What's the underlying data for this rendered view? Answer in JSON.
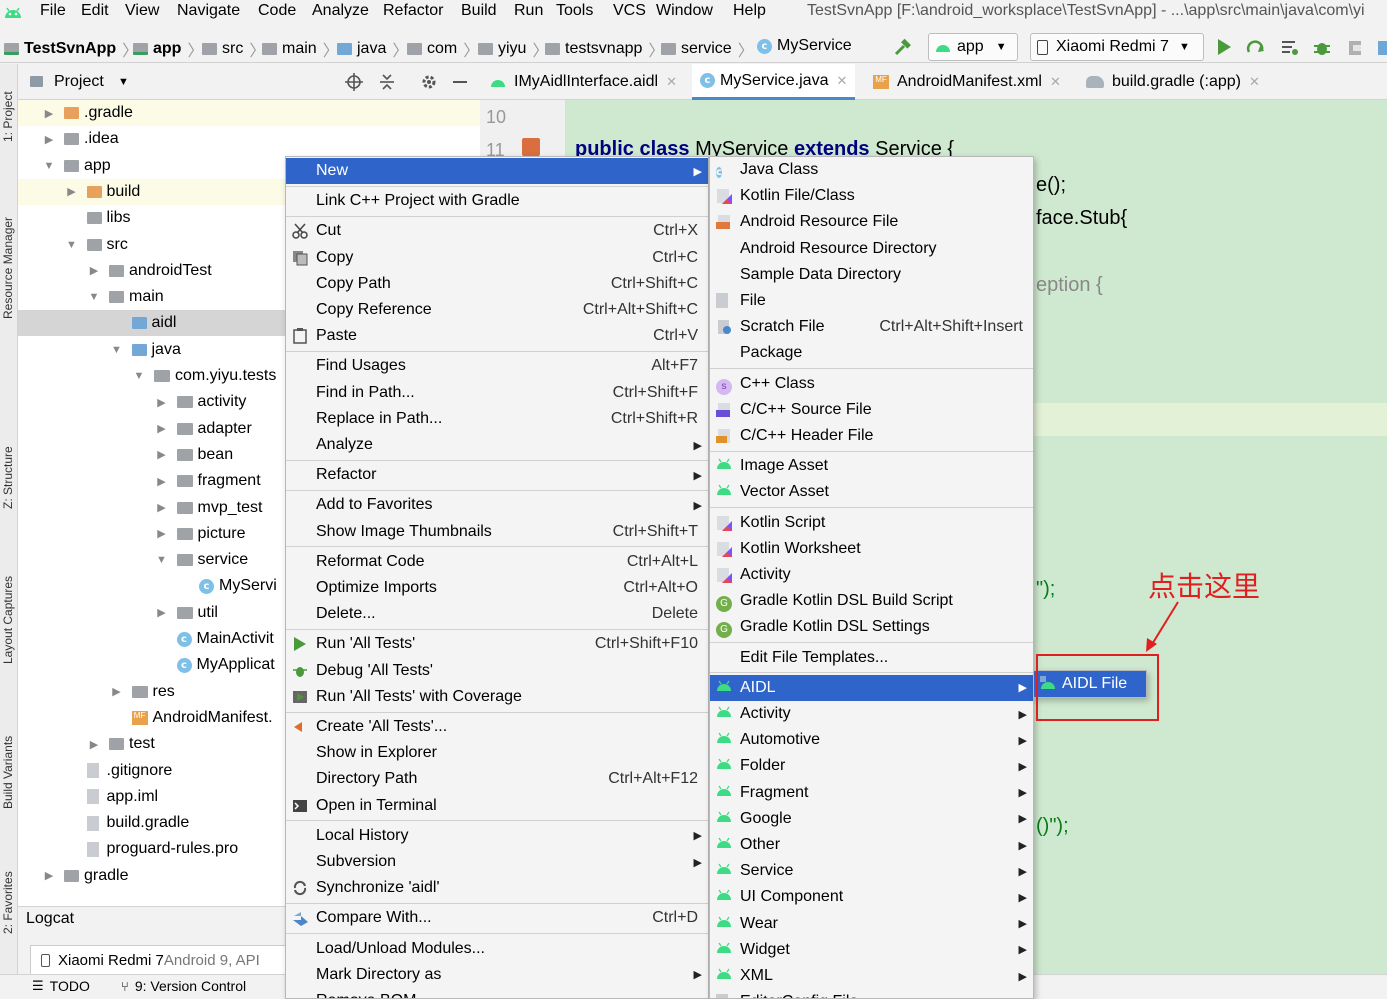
{
  "menubar": {
    "items": [
      "File",
      "Edit",
      "View",
      "Navigate",
      "Code",
      "Analyze",
      "Refactor",
      "Build",
      "Run",
      "Tools",
      "VCS",
      "Window",
      "Help"
    ],
    "title": "TestSvnApp [F:\\android_worksplace\\TestSvnApp] - ...\\app\\src\\main\\java\\com\\yi"
  },
  "breadcrumbs": [
    "TestSvnApp",
    "app",
    "src",
    "main",
    "java",
    "com",
    "yiyu",
    "testsvnapp",
    "service",
    "MyService"
  ],
  "toolbar": {
    "run_config": "app",
    "device": "Xiaomi Redmi 7"
  },
  "side_labels": {
    "project": "1: Project",
    "resource": "Resource Manager",
    "structure": "Z: Structure",
    "layout": "Layout Captures",
    "build_variants": "Build Variants",
    "favorites": "2: Favorites"
  },
  "project_panel": {
    "title": "Project",
    "tree": [
      {
        "label": ".gradle",
        "indent": 0,
        "arrow": "▶",
        "icon": "orange"
      },
      {
        "label": ".idea",
        "indent": 0,
        "arrow": "▶",
        "icon": "grey"
      },
      {
        "label": "app",
        "indent": 0,
        "arrow": "▼",
        "icon": "grey"
      },
      {
        "label": "build",
        "indent": 1,
        "arrow": "▶",
        "icon": "orange"
      },
      {
        "label": "libs",
        "indent": 1,
        "arrow": "",
        "icon": "grey"
      },
      {
        "label": "src",
        "indent": 1,
        "arrow": "▼",
        "icon": "grey"
      },
      {
        "label": "androidTest",
        "indent": 2,
        "arrow": "▶",
        "icon": "grey"
      },
      {
        "label": "main",
        "indent": 2,
        "arrow": "▼",
        "icon": "grey"
      },
      {
        "label": "aidl",
        "indent": 3,
        "arrow": "",
        "icon": "blue",
        "selected": true
      },
      {
        "label": "java",
        "indent": 3,
        "arrow": "▼",
        "icon": "blue"
      },
      {
        "label": "com.yiyu.tests",
        "indent": 4,
        "arrow": "▼",
        "icon": "pkg"
      },
      {
        "label": "activity",
        "indent": 5,
        "arrow": "▶",
        "icon": "pkg"
      },
      {
        "label": "adapter",
        "indent": 5,
        "arrow": "▶",
        "icon": "pkg"
      },
      {
        "label": "bean",
        "indent": 5,
        "arrow": "▶",
        "icon": "pkg"
      },
      {
        "label": "fragment",
        "indent": 5,
        "arrow": "▶",
        "icon": "pkg"
      },
      {
        "label": "mvp_test",
        "indent": 5,
        "arrow": "▶",
        "icon": "pkg"
      },
      {
        "label": "picture",
        "indent": 5,
        "arrow": "▶",
        "icon": "pkg"
      },
      {
        "label": "service",
        "indent": 5,
        "arrow": "▼",
        "icon": "pkg"
      },
      {
        "label": "MyServi",
        "indent": 6,
        "arrow": "",
        "icon": "class"
      },
      {
        "label": "util",
        "indent": 5,
        "arrow": "▶",
        "icon": "pkg"
      },
      {
        "label": "MainActivit",
        "indent": 5,
        "arrow": "",
        "icon": "class"
      },
      {
        "label": "MyApplicat",
        "indent": 5,
        "arrow": "",
        "icon": "class"
      },
      {
        "label": "res",
        "indent": 3,
        "arrow": "▶",
        "icon": "pkg"
      },
      {
        "label": "AndroidManifest.",
        "indent": 3,
        "arrow": "",
        "icon": "mf"
      },
      {
        "label": "test",
        "indent": 2,
        "arrow": "▶",
        "icon": "grey"
      },
      {
        "label": ".gitignore",
        "indent": 1,
        "arrow": "",
        "icon": "file"
      },
      {
        "label": "app.iml",
        "indent": 1,
        "arrow": "",
        "icon": "file"
      },
      {
        "label": "build.gradle",
        "indent": 1,
        "arrow": "",
        "icon": "file"
      },
      {
        "label": "proguard-rules.pro",
        "indent": 1,
        "arrow": "",
        "icon": "file"
      },
      {
        "label": "gradle",
        "indent": 0,
        "arrow": "▶",
        "icon": "grey"
      }
    ]
  },
  "editor": {
    "tabs": [
      "IMyAidlInterface.aidl",
      "MyService.java",
      "AndroidManifest.xml",
      "build.gradle (:app)"
    ],
    "line_numbers": [
      "10",
      "11"
    ],
    "code_line": {
      "kw1": "public class ",
      "name": "MyService ",
      "kw2": "extends ",
      "tail": "Service {"
    },
    "fragments": [
      "e();",
      "face.Stub{",
      "eption {",
      "\");",
      "()\");"
    ]
  },
  "logcat": {
    "title": "Logcat",
    "device": "Xiaomi Redmi 7",
    "device_detail": " Android 9, API"
  },
  "statusbar": {
    "todo": "TODO",
    "vc": "9: Version Control"
  },
  "context_menu": [
    {
      "label": "New",
      "shortcut": "",
      "submenu": true,
      "selected": true
    },
    {
      "sep": true
    },
    {
      "label": "Link C++ Project with Gradle",
      "shortcut": ""
    },
    {
      "sep": true
    },
    {
      "label": "Cut",
      "shortcut": "Ctrl+X",
      "icon": "cut"
    },
    {
      "label": "Copy",
      "shortcut": "Ctrl+C",
      "icon": "copy"
    },
    {
      "label": "Copy Path",
      "shortcut": "Ctrl+Shift+C"
    },
    {
      "label": "Copy Reference",
      "shortcut": "Ctrl+Alt+Shift+C"
    },
    {
      "label": "Paste",
      "shortcut": "Ctrl+V",
      "icon": "paste"
    },
    {
      "sep": true
    },
    {
      "label": "Find Usages",
      "shortcut": "Alt+F7"
    },
    {
      "label": "Find in Path...",
      "shortcut": "Ctrl+Shift+F"
    },
    {
      "label": "Replace in Path...",
      "shortcut": "Ctrl+Shift+R"
    },
    {
      "label": "Analyze",
      "shortcut": "",
      "submenu": true
    },
    {
      "sep": true
    },
    {
      "label": "Refactor",
      "shortcut": "",
      "submenu": true
    },
    {
      "sep": true
    },
    {
      "label": "Add to Favorites",
      "shortcut": "",
      "submenu": true
    },
    {
      "label": "Show Image Thumbnails",
      "shortcut": "Ctrl+Shift+T"
    },
    {
      "sep": true
    },
    {
      "label": "Reformat Code",
      "shortcut": "Ctrl+Alt+L"
    },
    {
      "label": "Optimize Imports",
      "shortcut": "Ctrl+Alt+O"
    },
    {
      "label": "Delete...",
      "shortcut": "Delete"
    },
    {
      "sep": true
    },
    {
      "label": "Run 'All Tests'",
      "shortcut": "Ctrl+Shift+F10",
      "icon": "run"
    },
    {
      "label": "Debug 'All Tests'",
      "shortcut": "",
      "icon": "debug"
    },
    {
      "label": "Run 'All Tests' with Coverage",
      "shortcut": "",
      "icon": "cov"
    },
    {
      "sep": true
    },
    {
      "label": "Create 'All Tests'...",
      "shortcut": "",
      "icon": "create"
    },
    {
      "label": "Show in Explorer",
      "shortcut": ""
    },
    {
      "label": "Directory Path",
      "shortcut": "Ctrl+Alt+F12"
    },
    {
      "label": "Open in Terminal",
      "shortcut": "",
      "icon": "term"
    },
    {
      "sep": true
    },
    {
      "label": "Local History",
      "shortcut": "",
      "submenu": true
    },
    {
      "label": "Subversion",
      "shortcut": "",
      "submenu": true
    },
    {
      "label": "Synchronize 'aidl'",
      "shortcut": "",
      "icon": "sync"
    },
    {
      "sep": true
    },
    {
      "label": "Compare With...",
      "shortcut": "Ctrl+D",
      "icon": "compare"
    },
    {
      "sep": true
    },
    {
      "label": "Load/Unload Modules...",
      "shortcut": ""
    },
    {
      "label": "Mark Directory as",
      "shortcut": "",
      "submenu": true
    },
    {
      "label": "Remove BOM",
      "shortcut": ""
    }
  ],
  "new_submenu": [
    {
      "label": "Java Class",
      "icon": "class"
    },
    {
      "label": "Kotlin File/Class",
      "icon": "kotlin"
    },
    {
      "label": "Android Resource File",
      "icon": "resfile"
    },
    {
      "label": "Android Resource Directory",
      "icon": "folder"
    },
    {
      "label": "Sample Data Directory",
      "icon": "folder"
    },
    {
      "label": "File",
      "icon": "file"
    },
    {
      "label": "Scratch File",
      "icon": "scratch",
      "shortcut": "Ctrl+Alt+Shift+Insert"
    },
    {
      "label": "Package",
      "icon": "folder"
    },
    {
      "sep": true
    },
    {
      "label": "C++ Class",
      "icon": "cpp"
    },
    {
      "label": "C/C++ Source File",
      "icon": "cppsrc"
    },
    {
      "label": "C/C++ Header File",
      "icon": "cpph"
    },
    {
      "sep": true
    },
    {
      "label": "Image Asset",
      "icon": "android"
    },
    {
      "label": "Vector Asset",
      "icon": "android"
    },
    {
      "sep": true
    },
    {
      "label": "Kotlin Script",
      "icon": "kotlin"
    },
    {
      "label": "Kotlin Worksheet",
      "icon": "kotlin"
    },
    {
      "label": "Activity",
      "icon": "kotlin"
    },
    {
      "label": "Gradle Kotlin DSL Build Script",
      "icon": "gradle"
    },
    {
      "label": "Gradle Kotlin DSL Settings",
      "icon": "gradle"
    },
    {
      "sep": true
    },
    {
      "label": "Edit File Templates...",
      "icon": ""
    },
    {
      "sep": true
    },
    {
      "label": "AIDL",
      "icon": "android",
      "submenu": true,
      "selected": true
    },
    {
      "label": "Activity",
      "icon": "android",
      "submenu": true
    },
    {
      "label": "Automotive",
      "icon": "android",
      "submenu": true
    },
    {
      "label": "Folder",
      "icon": "android",
      "submenu": true
    },
    {
      "label": "Fragment",
      "icon": "android",
      "submenu": true
    },
    {
      "label": "Google",
      "icon": "android",
      "submenu": true
    },
    {
      "label": "Other",
      "icon": "android",
      "submenu": true
    },
    {
      "label": "Service",
      "icon": "android",
      "submenu": true
    },
    {
      "label": "UI Component",
      "icon": "android",
      "submenu": true
    },
    {
      "label": "Wear",
      "icon": "android",
      "submenu": true
    },
    {
      "label": "Widget",
      "icon": "android",
      "submenu": true
    },
    {
      "label": "XML",
      "icon": "android",
      "submenu": true
    },
    {
      "label": "EditorConfig File",
      "icon": "file"
    }
  ],
  "aidl_submenu": {
    "item": "AIDL File"
  },
  "annotation": {
    "text": "点击这里"
  },
  "colors": {
    "selection": "#2f65ca",
    "editor_bg": "#cfe9d0",
    "annotation": "#e02020"
  }
}
